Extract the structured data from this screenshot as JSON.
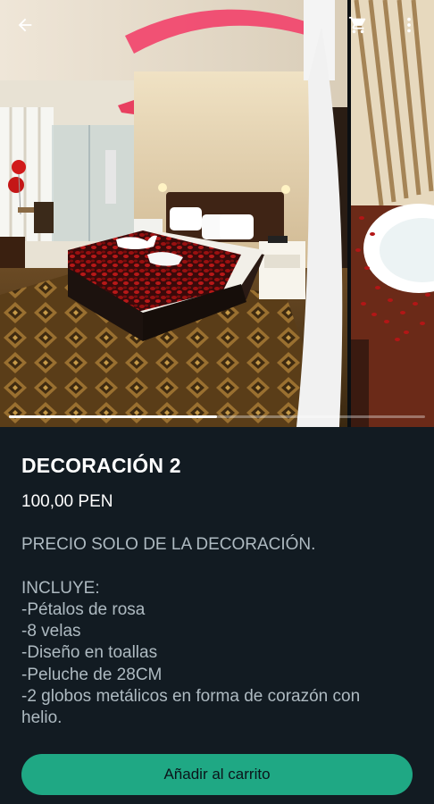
{
  "header": {
    "back_icon": "arrow-left-icon",
    "cart_icon": "shopping-cart-icon",
    "menu_icon": "more-vertical-icon"
  },
  "gallery": {
    "image_count": 2,
    "current_index": 1,
    "progress_fraction": 0.5
  },
  "product": {
    "name": "DECORACIÓN 2",
    "price": "100,00 PEN",
    "description_lines": [
      "PRECIO SOLO DE LA DECORACIÓN.",
      "",
      "INCLUYE:",
      "-Pétalos de rosa",
      "-8 velas",
      "-Diseño en toallas",
      "-Peluche de 28CM",
      "-2 globos metálicos en forma de corazón con",
      "helio."
    ]
  },
  "actions": {
    "add_to_cart_label": "Añadir al carrito"
  },
  "colors": {
    "background": "#121b22",
    "accent": "#1fa884",
    "button_text": "#0b141a",
    "secondary_text": "#aebac1"
  }
}
